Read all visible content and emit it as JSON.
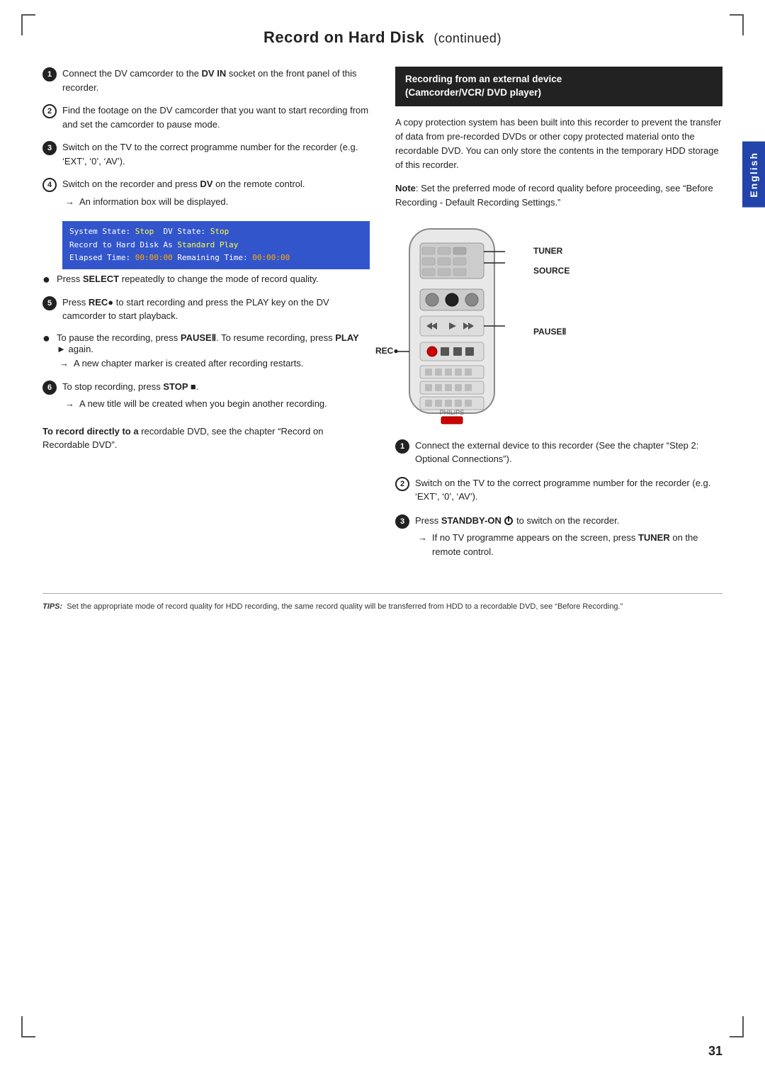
{
  "page": {
    "title": "Record on Hard Disk",
    "title_continued": "continued",
    "page_number": "31",
    "english_tab": "English"
  },
  "left_column": {
    "steps": [
      {
        "id": 1,
        "filled": true,
        "text": "Connect the DV camcorder to the <b>DV IN</b> socket on the front panel of this recorder."
      },
      {
        "id": 2,
        "filled": false,
        "text": "Find the footage on the DV camcorder that you want to start recording from and set the camcorder to pause mode."
      },
      {
        "id": 3,
        "filled": true,
        "text": "Switch on the TV to the correct programme number for the recorder (e.g. ‘EXT’, ‘0’, ‘AV’)."
      },
      {
        "id": 4,
        "filled": false,
        "text": "Switch on the recorder and press <b>DV</b> on the remote control."
      }
    ],
    "arrow_after_4": "→ An information box will be displayed.",
    "display_box": [
      "System State: Stop  DV State: Stop",
      "Record to Hard Disk As Standard Play",
      "Elapsed Time: 00:00:00 Remaining Time: 00:00:00"
    ],
    "bullets": [
      {
        "text": "Press <b>SELECT</b> repeatedly to change the mode of record quality."
      }
    ],
    "step5": {
      "id": 5,
      "filled": true,
      "text": "Press <b>REC●</b> to start recording and press the PLAY key on the DV camcorder to start playback."
    },
    "bullet2": {
      "text_prefix": "To pause the recording, press <b>PAUSEⅡ</b>. To resume recording, press <b>PLAY ►</b> again."
    },
    "arrow_after_bullet2": "→ A new chapter marker is created after recording restarts.",
    "step6": {
      "id": 6,
      "filled": true,
      "text": "To stop recording, press <b>STOP ■</b>."
    },
    "arrow_after_6": "→ A new title will be created when you begin another recording.",
    "to_record": {
      "bold": "To record directly to a",
      "rest": " recordable DVD, see the chapter “Record on Recordable DVD”."
    }
  },
  "right_column": {
    "section_heading_line1": "Recording from an external device",
    "section_heading_line2": "(Camcorder/VCR/ DVD player)",
    "intro_text": "A copy protection system has been built into this recorder to prevent the transfer of data from pre-recorded DVDs or other copy protected material onto the recordable DVD. You can only store the contents in the temporary HDD storage of this recorder.",
    "note_text": "Note: Set the preferred mode of record quality before proceeding, see “Before Recording - Default Recording Settings.”",
    "remote_labels": [
      {
        "label": "TUNER",
        "position": "top"
      },
      {
        "label": "SOURCE",
        "position": "mid-top"
      },
      {
        "label": "PAUSEⅡ",
        "position": "mid"
      }
    ],
    "rec_label": "REC ●",
    "right_steps": [
      {
        "id": 1,
        "filled": true,
        "text": "Connect the external device to this recorder (See the chapter “Step 2: Optional Connections”)."
      },
      {
        "id": 2,
        "filled": false,
        "text": "Switch on the TV to the correct programme number for the recorder (e.g. ‘EXT’, ‘0’, ‘AV’)."
      },
      {
        "id": 3,
        "filled": true,
        "text_prefix": "Press <b>STANDBY-ON</b>",
        "text_suffix": " to switch on the recorder.",
        "arrow": "→ If no TV programme appears on the screen, press <b>TUNER</b> on the remote control."
      }
    ]
  },
  "tips": {
    "label": "TIPS:",
    "text": "Set the appropriate mode of record quality for HDD recording, the same record quality will be transferred from HDD to a recordable DVD, see “Before Recording.”"
  }
}
